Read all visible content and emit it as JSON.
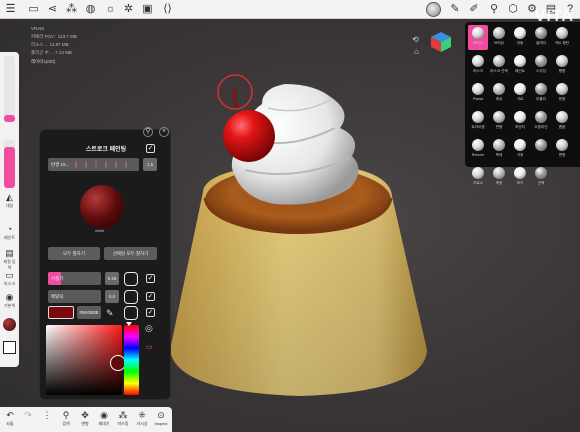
{
  "topbar": {
    "left_icons": [
      "menu-icon",
      "folder-icon",
      "share-icon",
      "scene-icon",
      "globe-icon",
      "sun-icon",
      "gear-icon",
      "image-icon",
      "code-icon"
    ],
    "right_icons": [
      "pen-icon",
      "paint-icon",
      "pin-icon",
      "box-icon",
      "gear-icon",
      "layout-icon",
      "help-icon"
    ]
  },
  "stats": {
    "line1": "VRAM",
    "line2": "카메라 FOV : 123.7 MB",
    "line3": "리소스 ... 11.87 MB",
    "line4": "폴리곤 수 ... 7.13 MB"
  },
  "layer_name": "레이어1(0/0)",
  "brand": "VITA",
  "left_sidebar": {
    "radius_fill": 0.1,
    "intensity_fill": 0.85,
    "buttons": [
      {
        "label": "대칭",
        "icon": "symmetry-icon"
      },
      {
        "label": "페인트",
        "icon": "drop-icon"
      },
      {
        "label": "재질 입력",
        "icon": "material-icon"
      },
      {
        "label": "마스크",
        "icon": "mask-icon"
      },
      {
        "label": "기본색",
        "icon": "sphere-icon"
      }
    ]
  },
  "bottombar": [
    {
      "label": "되돌",
      "icon": "undo-icon"
    },
    {
      "label": "",
      "icon": "redo-icon"
    },
    {
      "label": "",
      "icon": "list-icon"
    },
    {
      "label": "검색",
      "icon": "search-icon"
    },
    {
      "label": "변형",
      "icon": "transform-icon"
    },
    {
      "label": "재대기",
      "icon": "eye-icon"
    },
    {
      "label": "마스킹",
      "icon": "mask-icon"
    },
    {
      "label": "가시성",
      "icon": "visibility-icon"
    },
    {
      "label": "Inspect",
      "icon": "inspect-icon"
    }
  ],
  "paint_panel": {
    "title": "스트로크 페인팅",
    "radius": {
      "label": "반경 15...",
      "value": "1.5"
    },
    "material_label": "white",
    "btn_paint_all": "모두 칠하기",
    "btn_paint_visible": "선택된 모두 칠하기",
    "roughness": {
      "label": "거칠기",
      "value": "0.25"
    },
    "metalness": {
      "label": "메탈릭",
      "value": "0.0"
    },
    "color_hex": "#5E0B0B",
    "color_label": "#5E0B0B",
    "colors": {
      "accent": "#F04DA0",
      "selected_color": "#7A0A0A"
    }
  },
  "tool_panel": {
    "tools": [
      {
        "label": "브러시",
        "active": true
      },
      {
        "label": "브러쉬",
        "active": false
      },
      {
        "label": "이동",
        "active": false
      },
      {
        "label": "클레이",
        "active": false
      },
      {
        "label": "넥트 평탄",
        "active": false
      },
      {
        "label": "마스크",
        "active": false
      },
      {
        "label": "마스크 선택",
        "active": false
      },
      {
        "label": "페인트",
        "active": false
      },
      {
        "label": "스무딩",
        "active": false
      },
      {
        "label": "평평",
        "active": false
      },
      {
        "label": "Planar",
        "active": false
      },
      {
        "label": "메쉬",
        "active": false
      },
      {
        "label": "가로",
        "active": false
      },
      {
        "label": "부풀리",
        "active": false
      },
      {
        "label": "문형",
        "active": false
      },
      {
        "label": "트라이앵",
        "active": false
      },
      {
        "label": "변형",
        "active": false
      },
      {
        "label": "포밍지",
        "active": false
      },
      {
        "label": "쏘핑라인",
        "active": false
      },
      {
        "label": "좁음",
        "active": false
      },
      {
        "label": "Relaxer",
        "active": false
      },
      {
        "label": "복제",
        "active": false
      },
      {
        "label": "가위",
        "active": false
      },
      {
        "label": "",
        "active": false
      },
      {
        "label": "변형",
        "active": false
      },
      {
        "label": "자로소",
        "active": false
      },
      {
        "label": "측정",
        "active": false
      },
      {
        "label": "보기",
        "active": false
      },
      {
        "label": "선택",
        "active": false
      }
    ]
  }
}
